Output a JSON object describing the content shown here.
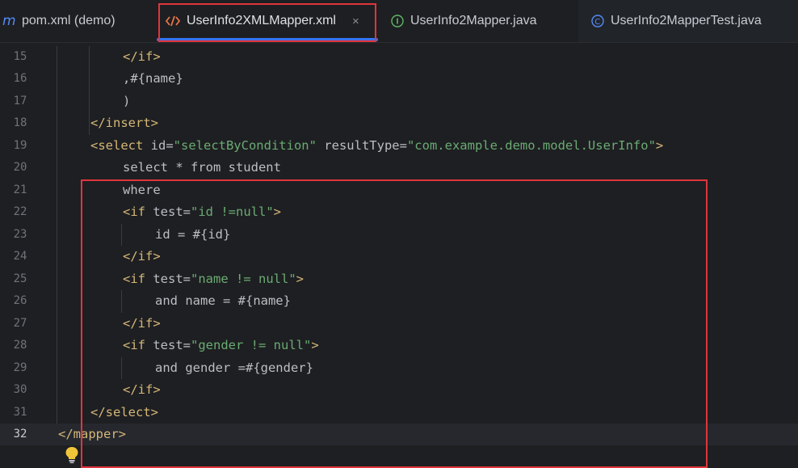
{
  "tabs": [
    {
      "label": "pom.xml (demo)",
      "icon": "maven-m-icon"
    },
    {
      "label": "UserInfo2XMLMapper.xml",
      "icon": "xml-tag-icon",
      "active": true
    },
    {
      "label": "UserInfo2Mapper.java",
      "icon": "interface-i-icon"
    },
    {
      "label": "UserInfo2MapperTest.java",
      "icon": "class-c-icon"
    }
  ],
  "close_glyph": "×",
  "editor": {
    "current_line": 32,
    "lines": [
      {
        "n": "15",
        "t": [
          "</if>"
        ]
      },
      {
        "n": "16",
        "t": [
          ",#{name}"
        ]
      },
      {
        "n": "17",
        "t": [
          ")"
        ]
      },
      {
        "n": "18",
        "t": [
          "</insert>"
        ]
      },
      {
        "n": "19",
        "t": [
          "<select",
          " id=",
          "\"selectByCondition\"",
          " resultType=",
          "\"com.example.demo.model.UserInfo\"",
          ">"
        ]
      },
      {
        "n": "20",
        "t": [
          "select * from student"
        ]
      },
      {
        "n": "21",
        "t": [
          "where"
        ]
      },
      {
        "n": "22",
        "t": [
          "<if",
          " test=",
          "\"id !=null\"",
          ">"
        ]
      },
      {
        "n": "23",
        "t": [
          "id = #{id}"
        ]
      },
      {
        "n": "24",
        "t": [
          "</if>"
        ]
      },
      {
        "n": "25",
        "t": [
          "<if",
          " test=",
          "\"name != null\"",
          ">"
        ]
      },
      {
        "n": "26",
        "t": [
          "and name = #{name}"
        ]
      },
      {
        "n": "27",
        "t": [
          "</if>"
        ]
      },
      {
        "n": "28",
        "t": [
          "<if",
          " test=",
          "\"gender != null\"",
          ">"
        ]
      },
      {
        "n": "29",
        "t": [
          "and gender =#{gender}"
        ]
      },
      {
        "n": "30",
        "t": [
          "</if>"
        ]
      },
      {
        "n": "31",
        "t": [
          "</select>"
        ]
      },
      {
        "n": "32",
        "t": [
          "</mapper>"
        ]
      }
    ]
  },
  "colors": {
    "accent": "#3574f0",
    "highlight_box": "#e0353d",
    "tag": "#d5b778",
    "string": "#6aab73",
    "bulb": "#f0c53a"
  },
  "intention_icon": "lightbulb-icon"
}
